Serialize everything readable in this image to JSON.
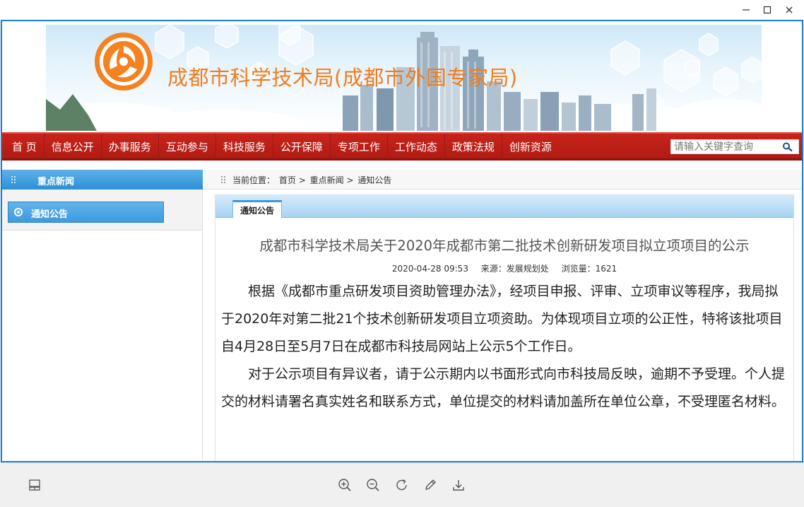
{
  "window": {
    "controls": [
      "minimize-icon",
      "maximize-icon",
      "close-icon"
    ]
  },
  "banner": {
    "title": "成都市科学技术局(成都市外国专家局)"
  },
  "nav": {
    "items": [
      "首 页",
      "信息公开",
      "办事服务",
      "互动参与",
      "科技服务",
      "公开保障",
      "专项工作",
      "工作动态",
      "政策法规",
      "创新资源"
    ],
    "search_placeholder": "请输入关键字查询"
  },
  "sidebar": {
    "heading": "重点新闻",
    "items": [
      {
        "label": "通知公告"
      }
    ]
  },
  "breadcrumb": {
    "prefix": "当前位置：",
    "home": "首页",
    "sep1": ">",
    "section": "重点新闻",
    "sep2": ">",
    "current": "通知公告"
  },
  "article": {
    "tab": "通知公告",
    "title": "成都市科学技术局关于2020年成都市第二批技术创新研发项目拟立项项目的公示",
    "date": "2020-04-28 09:53",
    "source": "来源：发展规划处",
    "views": "浏览量：1621",
    "paragraphs": [
      "根据《成都市重点研发项目资助管理办法》，经项目申报、评审、立项审议等程序，我局拟于2020年对第二批21个技术创新研发项目立项资助。为体现项目立项的公正性，特将该批项目自4月28日至5月7日在成都市科技局网站上公示5个工作日。",
      "对于公示项目有异议者，请于公示期内以书面形式向市科技局反映，逾期不予受理。个人提交的材料请署名真实姓名和联系方式，单位提交的材料请加盖所在单位公章，不受理匿名材料。"
    ]
  },
  "toolbar": {
    "tools": [
      "layout-icon",
      "zoom-in-icon",
      "zoom-out-icon",
      "rotate-icon",
      "edit-icon",
      "download-icon"
    ]
  },
  "colors": {
    "accent_blue": "#1a7fd6",
    "nav_red": "#b01b13",
    "title_orange": "#f07d1e"
  }
}
